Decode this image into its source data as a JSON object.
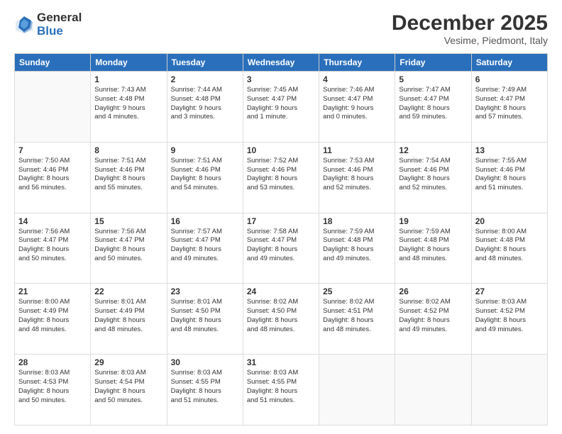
{
  "logo": {
    "general": "General",
    "blue": "Blue"
  },
  "title": "December 2025",
  "subtitle": "Vesime, Piedmont, Italy",
  "days_of_week": [
    "Sunday",
    "Monday",
    "Tuesday",
    "Wednesday",
    "Thursday",
    "Friday",
    "Saturday"
  ],
  "weeks": [
    [
      {
        "day": "",
        "info": ""
      },
      {
        "day": "1",
        "info": "Sunrise: 7:43 AM\nSunset: 4:48 PM\nDaylight: 9 hours\nand 4 minutes."
      },
      {
        "day": "2",
        "info": "Sunrise: 7:44 AM\nSunset: 4:48 PM\nDaylight: 9 hours\nand 3 minutes."
      },
      {
        "day": "3",
        "info": "Sunrise: 7:45 AM\nSunset: 4:47 PM\nDaylight: 9 hours\nand 1 minute."
      },
      {
        "day": "4",
        "info": "Sunrise: 7:46 AM\nSunset: 4:47 PM\nDaylight: 9 hours\nand 0 minutes."
      },
      {
        "day": "5",
        "info": "Sunrise: 7:47 AM\nSunset: 4:47 PM\nDaylight: 8 hours\nand 59 minutes."
      },
      {
        "day": "6",
        "info": "Sunrise: 7:49 AM\nSunset: 4:47 PM\nDaylight: 8 hours\nand 57 minutes."
      }
    ],
    [
      {
        "day": "7",
        "info": "Sunrise: 7:50 AM\nSunset: 4:46 PM\nDaylight: 8 hours\nand 56 minutes."
      },
      {
        "day": "8",
        "info": "Sunrise: 7:51 AM\nSunset: 4:46 PM\nDaylight: 8 hours\nand 55 minutes."
      },
      {
        "day": "9",
        "info": "Sunrise: 7:51 AM\nSunset: 4:46 PM\nDaylight: 8 hours\nand 54 minutes."
      },
      {
        "day": "10",
        "info": "Sunrise: 7:52 AM\nSunset: 4:46 PM\nDaylight: 8 hours\nand 53 minutes."
      },
      {
        "day": "11",
        "info": "Sunrise: 7:53 AM\nSunset: 4:46 PM\nDaylight: 8 hours\nand 52 minutes."
      },
      {
        "day": "12",
        "info": "Sunrise: 7:54 AM\nSunset: 4:46 PM\nDaylight: 8 hours\nand 52 minutes."
      },
      {
        "day": "13",
        "info": "Sunrise: 7:55 AM\nSunset: 4:46 PM\nDaylight: 8 hours\nand 51 minutes."
      }
    ],
    [
      {
        "day": "14",
        "info": "Sunrise: 7:56 AM\nSunset: 4:47 PM\nDaylight: 8 hours\nand 50 minutes."
      },
      {
        "day": "15",
        "info": "Sunrise: 7:56 AM\nSunset: 4:47 PM\nDaylight: 8 hours\nand 50 minutes."
      },
      {
        "day": "16",
        "info": "Sunrise: 7:57 AM\nSunset: 4:47 PM\nDaylight: 8 hours\nand 49 minutes."
      },
      {
        "day": "17",
        "info": "Sunrise: 7:58 AM\nSunset: 4:47 PM\nDaylight: 8 hours\nand 49 minutes."
      },
      {
        "day": "18",
        "info": "Sunrise: 7:59 AM\nSunset: 4:48 PM\nDaylight: 8 hours\nand 49 minutes."
      },
      {
        "day": "19",
        "info": "Sunrise: 7:59 AM\nSunset: 4:48 PM\nDaylight: 8 hours\nand 48 minutes."
      },
      {
        "day": "20",
        "info": "Sunrise: 8:00 AM\nSunset: 4:48 PM\nDaylight: 8 hours\nand 48 minutes."
      }
    ],
    [
      {
        "day": "21",
        "info": "Sunrise: 8:00 AM\nSunset: 4:49 PM\nDaylight: 8 hours\nand 48 minutes."
      },
      {
        "day": "22",
        "info": "Sunrise: 8:01 AM\nSunset: 4:49 PM\nDaylight: 8 hours\nand 48 minutes."
      },
      {
        "day": "23",
        "info": "Sunrise: 8:01 AM\nSunset: 4:50 PM\nDaylight: 8 hours\nand 48 minutes."
      },
      {
        "day": "24",
        "info": "Sunrise: 8:02 AM\nSunset: 4:50 PM\nDaylight: 8 hours\nand 48 minutes."
      },
      {
        "day": "25",
        "info": "Sunrise: 8:02 AM\nSunset: 4:51 PM\nDaylight: 8 hours\nand 48 minutes."
      },
      {
        "day": "26",
        "info": "Sunrise: 8:02 AM\nSunset: 4:52 PM\nDaylight: 8 hours\nand 49 minutes."
      },
      {
        "day": "27",
        "info": "Sunrise: 8:03 AM\nSunset: 4:52 PM\nDaylight: 8 hours\nand 49 minutes."
      }
    ],
    [
      {
        "day": "28",
        "info": "Sunrise: 8:03 AM\nSunset: 4:53 PM\nDaylight: 8 hours\nand 50 minutes."
      },
      {
        "day": "29",
        "info": "Sunrise: 8:03 AM\nSunset: 4:54 PM\nDaylight: 8 hours\nand 50 minutes."
      },
      {
        "day": "30",
        "info": "Sunrise: 8:03 AM\nSunset: 4:55 PM\nDaylight: 8 hours\nand 51 minutes."
      },
      {
        "day": "31",
        "info": "Sunrise: 8:03 AM\nSunset: 4:55 PM\nDaylight: 8 hours\nand 51 minutes."
      },
      {
        "day": "",
        "info": ""
      },
      {
        "day": "",
        "info": ""
      },
      {
        "day": "",
        "info": ""
      }
    ]
  ]
}
